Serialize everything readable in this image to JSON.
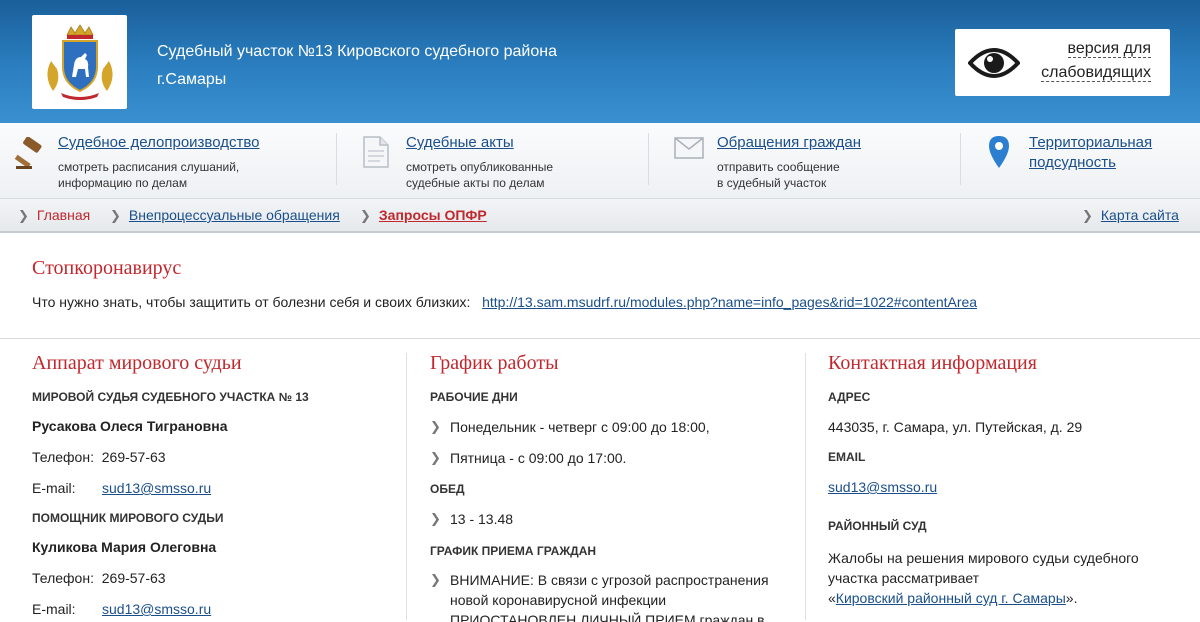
{
  "header": {
    "title_line1": "Судебный участок №13 Кировского судебного района",
    "title_line2": "г.Самары",
    "vision_line1": "версия для",
    "vision_line2": "слабовидящих"
  },
  "nav": [
    {
      "link": "Судебное делопроизводство",
      "desc1": "смотреть расписания слушаний,",
      "desc2": "информацию по делам",
      "icon": "gavel-icon"
    },
    {
      "link": "Судебные акты",
      "desc1": "смотреть опубликованные",
      "desc2": "судебные акты по делам",
      "icon": "document-icon"
    },
    {
      "link": "Обращения граждан",
      "desc1": "отправить сообщение",
      "desc2": "в судебный участок",
      "icon": "envelope-icon"
    },
    {
      "link1": "Территориальная",
      "link2": "подсудность",
      "icon": "map-pin-icon"
    }
  ],
  "breadcrumb": {
    "home": "Главная",
    "section": "Внепроцессуальные обращения",
    "current": "Запросы ОПФР",
    "sitemap": "Карта сайта"
  },
  "covid": {
    "title": "Стопкоронавирус",
    "text": "Что нужно знать, чтобы защитить от болезни себя и своих близких:",
    "link": "http://13.sam.msudrf.ru/modules.php?name=info_pages&rid=1022#contentArea"
  },
  "apparatus": {
    "title": "Аппарат мирового судьи",
    "judge_label": "МИРОВОЙ СУДЬЯ СУДЕБНОГО УЧАСТКА № 13",
    "judge_name": "Русакова Олеся Тиграновна",
    "phone_label": "Телефон:",
    "judge_phone": "269-57-63",
    "email_label": "E-mail:",
    "judge_email": "sud13@smsso.ru",
    "assistant_label": "ПОМОЩНИК МИРОВОГО СУДЬИ",
    "assistant_name": "Куликова Мария Олеговна",
    "assistant_phone": "269-57-63",
    "assistant_email": "sud13@smsso.ru"
  },
  "schedule": {
    "title": "График работы",
    "workdays_label": "РАБОЧИЕ ДНИ",
    "workdays": [
      "Понедельник - четверг с 09:00 до 18:00,",
      "Пятница - с 09:00 до 17:00."
    ],
    "lunch_label": "ОБЕД",
    "lunch": "13 - 13.48",
    "reception_label": "ГРАФИК ПРИЕМА ГРАЖДАН",
    "reception_line1": "ВНИМАНИЕ: В связи с угрозой распространения",
    "reception_line2": "новой коронавирусной инфекции",
    "reception_line3": "ПРИОСТАНОВЛЕН ЛИЧНЫЙ ПРИЕМ граждан в"
  },
  "contacts": {
    "title": "Контактная информация",
    "address_label": "АДРЕС",
    "address": "443035, г. Самара, ул. Путейская, д. 29",
    "email_label": "EMAIL",
    "email": "sud13@smsso.ru",
    "district_label": "РАЙОННЫЙ СУД",
    "district_line1": "Жалобы на решения мирового судьи судебного",
    "district_line2": "участка рассматривает",
    "district_quote_open": "«",
    "district_link": "Кировский районный суд г. Самары",
    "district_quote_close": "»."
  },
  "colors": {
    "header_blue": "#2b7fc0",
    "accent_red": "#c0282d",
    "link_blue": "#1a4f8b"
  }
}
